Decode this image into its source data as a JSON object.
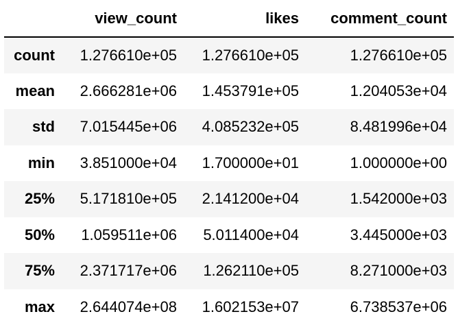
{
  "table": {
    "columns": [
      "",
      "view_count",
      "likes",
      "comment_count"
    ],
    "rows": [
      {
        "label": "count",
        "values": [
          "1.276610e+05",
          "1.276610e+05",
          "1.276610e+05"
        ]
      },
      {
        "label": "mean",
        "values": [
          "2.666281e+06",
          "1.453791e+05",
          "1.204053e+04"
        ]
      },
      {
        "label": "std",
        "values": [
          "7.015445e+06",
          "4.085232e+05",
          "8.481996e+04"
        ]
      },
      {
        "label": "min",
        "values": [
          "3.851000e+04",
          "1.700000e+01",
          "1.000000e+00"
        ]
      },
      {
        "label": "25%",
        "values": [
          "5.171810e+05",
          "2.141200e+04",
          "1.542000e+03"
        ]
      },
      {
        "label": "50%",
        "values": [
          "1.059511e+06",
          "5.011400e+04",
          "3.445000e+03"
        ]
      },
      {
        "label": "75%",
        "values": [
          "2.371717e+06",
          "1.262110e+05",
          "8.271000e+03"
        ]
      },
      {
        "label": "max",
        "values": [
          "2.644074e+08",
          "1.602153e+07",
          "6.738537e+06"
        ]
      }
    ]
  },
  "colors": {
    "header_border": "#000000",
    "stripe": "#f5f5f5",
    "background": "#ffffff"
  }
}
